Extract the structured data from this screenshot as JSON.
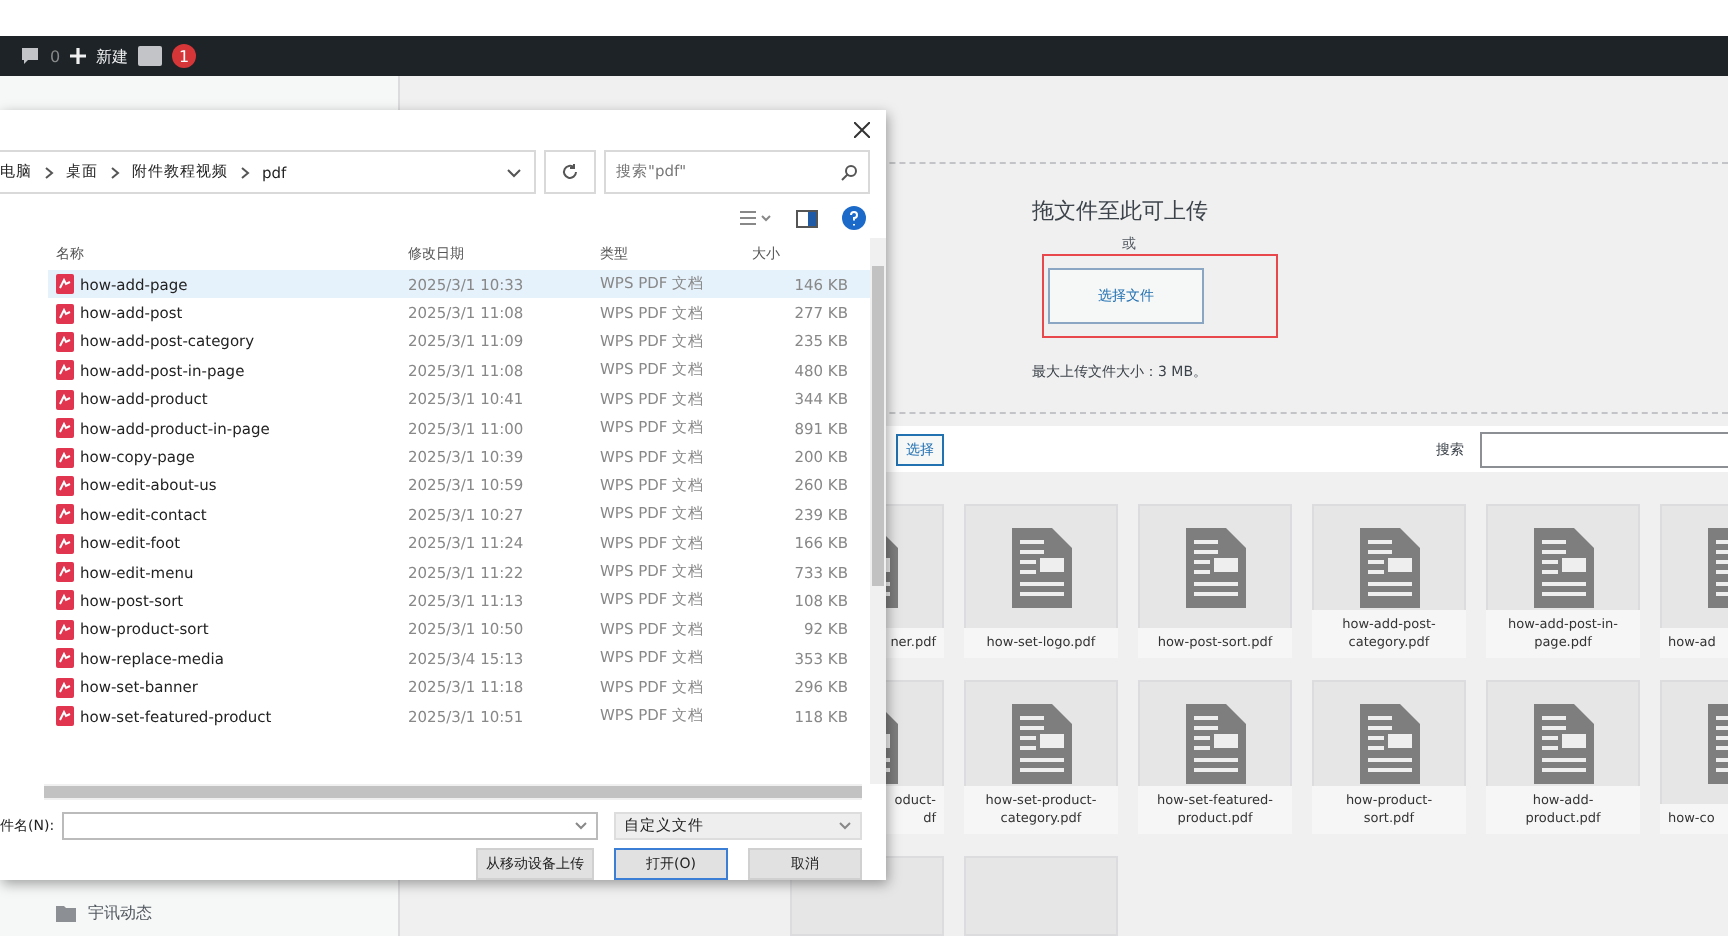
{
  "admin_bar": {
    "comments": "0",
    "new": "新建",
    "badge": "1"
  },
  "upload": {
    "heading": "拖文件至此可上传",
    "or": "或",
    "select_button": "选择文件",
    "max_size": "最大上传文件大小：3 MB。"
  },
  "media_toolbar": {
    "select_button": "选择",
    "search_label": "搜索"
  },
  "media_grid": [
    [
      {
        "lines": [
          "ner.pdf"
        ]
      },
      {
        "lines": [
          "how-set-logo.pdf"
        ]
      },
      {
        "lines": [
          "how-post-sort.pdf"
        ]
      },
      {
        "lines": [
          "how-add-post-",
          "category.pdf"
        ]
      },
      {
        "lines": [
          "how-add-post-in-",
          "page.pdf"
        ]
      },
      {
        "lines": [
          "how-ad"
        ]
      }
    ],
    [
      {
        "lines": [
          "oduct-",
          "df"
        ]
      },
      {
        "lines": [
          "how-set-product-",
          "category.pdf"
        ]
      },
      {
        "lines": [
          "how-set-featured-",
          "product.pdf"
        ]
      },
      {
        "lines": [
          "how-product-",
          "sort.pdf"
        ]
      },
      {
        "lines": [
          "how-add-",
          "product.pdf"
        ]
      },
      {
        "lines": [
          "how-co"
        ]
      }
    ]
  ],
  "sidebar": {
    "item": "宇讯动态"
  },
  "dialog": {
    "breadcrumb": [
      "电脑",
      "桌面",
      "附件教程视频",
      "pdf"
    ],
    "search_placeholder": "搜索\"pdf\"",
    "columns": [
      "名称",
      "修改日期",
      "类型",
      "大小"
    ],
    "files": [
      {
        "name": "how-add-page",
        "date": "2025/3/1 10:33",
        "type": "WPS PDF 文档",
        "size": "146 KB",
        "selected": true
      },
      {
        "name": "how-add-post",
        "date": "2025/3/1 11:08",
        "type": "WPS PDF 文档",
        "size": "277 KB",
        "selected": false
      },
      {
        "name": "how-add-post-category",
        "date": "2025/3/1 11:09",
        "type": "WPS PDF 文档",
        "size": "235 KB",
        "selected": false
      },
      {
        "name": "how-add-post-in-page",
        "date": "2025/3/1 11:08",
        "type": "WPS PDF 文档",
        "size": "480 KB",
        "selected": false
      },
      {
        "name": "how-add-product",
        "date": "2025/3/1 10:41",
        "type": "WPS PDF 文档",
        "size": "344 KB",
        "selected": false
      },
      {
        "name": "how-add-product-in-page",
        "date": "2025/3/1 11:00",
        "type": "WPS PDF 文档",
        "size": "891 KB",
        "selected": false
      },
      {
        "name": "how-copy-page",
        "date": "2025/3/1 10:39",
        "type": "WPS PDF 文档",
        "size": "200 KB",
        "selected": false
      },
      {
        "name": "how-edit-about-us",
        "date": "2025/3/1 10:59",
        "type": "WPS PDF 文档",
        "size": "260 KB",
        "selected": false
      },
      {
        "name": "how-edit-contact",
        "date": "2025/3/1 10:27",
        "type": "WPS PDF 文档",
        "size": "239 KB",
        "selected": false
      },
      {
        "name": "how-edit-foot",
        "date": "2025/3/1 11:24",
        "type": "WPS PDF 文档",
        "size": "166 KB",
        "selected": false
      },
      {
        "name": "how-edit-menu",
        "date": "2025/3/1 11:22",
        "type": "WPS PDF 文档",
        "size": "733 KB",
        "selected": false
      },
      {
        "name": "how-post-sort",
        "date": "2025/3/1 11:13",
        "type": "WPS PDF 文档",
        "size": "108 KB",
        "selected": false
      },
      {
        "name": "how-product-sort",
        "date": "2025/3/1 10:50",
        "type": "WPS PDF 文档",
        "size": "92 KB",
        "selected": false
      },
      {
        "name": "how-replace-media",
        "date": "2025/3/4 15:13",
        "type": "WPS PDF 文档",
        "size": "353 KB",
        "selected": false
      },
      {
        "name": "how-set-banner",
        "date": "2025/3/1 11:18",
        "type": "WPS PDF 文档",
        "size": "296 KB",
        "selected": false
      },
      {
        "name": "how-set-featured-product",
        "date": "2025/3/1 10:51",
        "type": "WPS PDF 文档",
        "size": "118 KB",
        "selected": false
      }
    ],
    "filename_label": "件名(N):",
    "filter": "自定义文件",
    "buttons": [
      "从移动设备上传",
      "打开(O)",
      "取消"
    ]
  }
}
